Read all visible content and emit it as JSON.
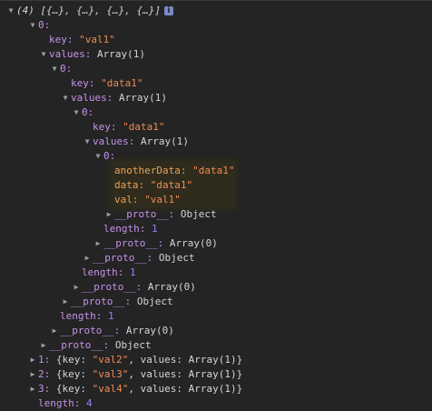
{
  "root": {
    "summary": "(4) [{…}, {…}, {…}, {…}]",
    "info_badge": "i"
  },
  "item0": {
    "label": "0:",
    "key_name": "key:",
    "key_value": "\"val1\"",
    "values_name": "values:",
    "values_type": "Array(1)",
    "lvl2": {
      "label": "0:",
      "key_name": "key:",
      "key_value": "\"data1\"",
      "values_name": "values:",
      "values_type": "Array(1)",
      "lvl3": {
        "label": "0:",
        "key_name": "key:",
        "key_value": "\"data1\"",
        "values_name": "values:",
        "values_type": "Array(1)",
        "lvl4": {
          "label": "0:",
          "another_name": "anotherData:",
          "another_value": "\"data1\"",
          "data_name": "data:",
          "data_value": "\"data1\"",
          "val_name": "val:",
          "val_value": "\"val1\"",
          "proto_name": "__proto__:",
          "proto_value": "Object"
        },
        "length_name": "length:",
        "length_value": "1",
        "proto_name": "__proto__:",
        "proto_value": "Array(0)"
      },
      "proto_name": "__proto__:",
      "proto_value": "Object"
    },
    "length_name": "length:",
    "length_value": "1",
    "arr_proto_name": "__proto__:",
    "arr_proto_value": "Array(0)",
    "obj_proto_name": "__proto__:",
    "obj_proto_value": "Object"
  },
  "item0_outer": {
    "length_name": "length:",
    "length_value": "1",
    "arr_proto_name": "__proto__:",
    "arr_proto_value": "Array(0)",
    "obj_proto_name": "__proto__:",
    "obj_proto_value": "Object"
  },
  "items": [
    {
      "label": "1:",
      "open": "{key: ",
      "key_value": "\"val2\"",
      "mid": ", values: ",
      "values_type": "Array(1)",
      "close": "}"
    },
    {
      "label": "2:",
      "open": "{key: ",
      "key_value": "\"val3\"",
      "mid": ", values: ",
      "values_type": "Array(1)",
      "close": "}"
    },
    {
      "label": "3:",
      "open": "{key: ",
      "key_value": "\"val4\"",
      "mid": ", values: ",
      "values_type": "Array(1)",
      "close": "}"
    }
  ],
  "root_length": {
    "name": "length:",
    "value": "4"
  },
  "colors": {
    "background": "#242424",
    "key": "#c792ea",
    "string": "#f28b54",
    "number": "#9980ff",
    "highlight": "#2f2c1d"
  }
}
